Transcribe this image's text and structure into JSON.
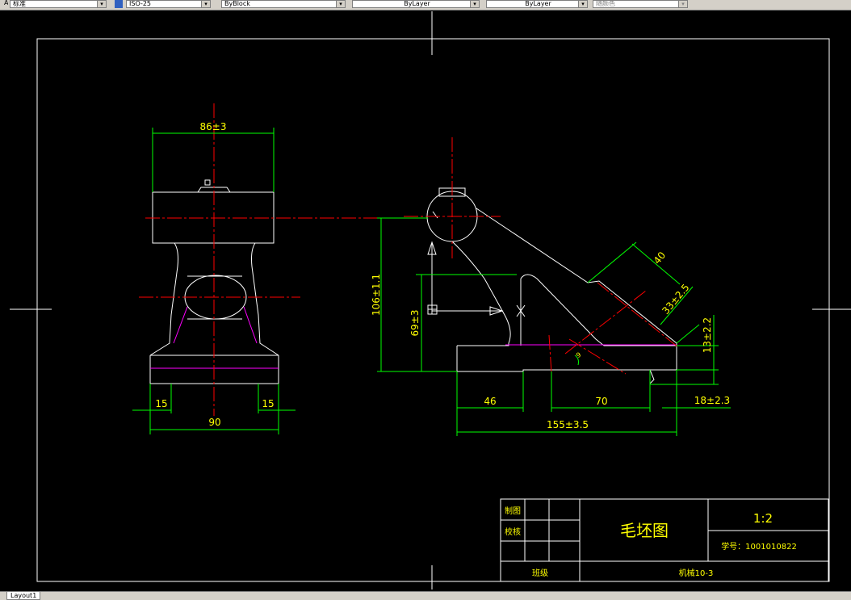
{
  "toolbar": {
    "textstyle": "标准",
    "dimstyle": "ISO-25",
    "color": "ByBlock",
    "linetype": "ByLayer",
    "lineweight": "ByLayer",
    "plotstyle": "随颜色",
    "dropdown_arrow": "▾"
  },
  "drawing": {
    "dims": {
      "d86": "86±3",
      "d15_left": "15",
      "d15_right": "15",
      "d90": "90",
      "d106": "106±1.1",
      "d69": "69±3",
      "d46": "46",
      "d70": "70",
      "d155": "155±3.5",
      "d18": "18±2.3",
      "d13": "13±2.2",
      "d33": "33±2.5",
      "d40": "40",
      "d9": "9"
    },
    "title_block": {
      "row1": "制图",
      "row2": "校核",
      "row3": "班级",
      "title": "毛坯图",
      "scale": "1:2",
      "student_id": "学号：1001010822",
      "class": "机械10-3"
    }
  },
  "tabs": {
    "layout1": "Layout1"
  },
  "colors": {
    "outline": "#ffffff",
    "centerline": "#ff0000",
    "dimension": "#00ff00",
    "hidden": "#ff00ff",
    "text": "#ffff00"
  }
}
